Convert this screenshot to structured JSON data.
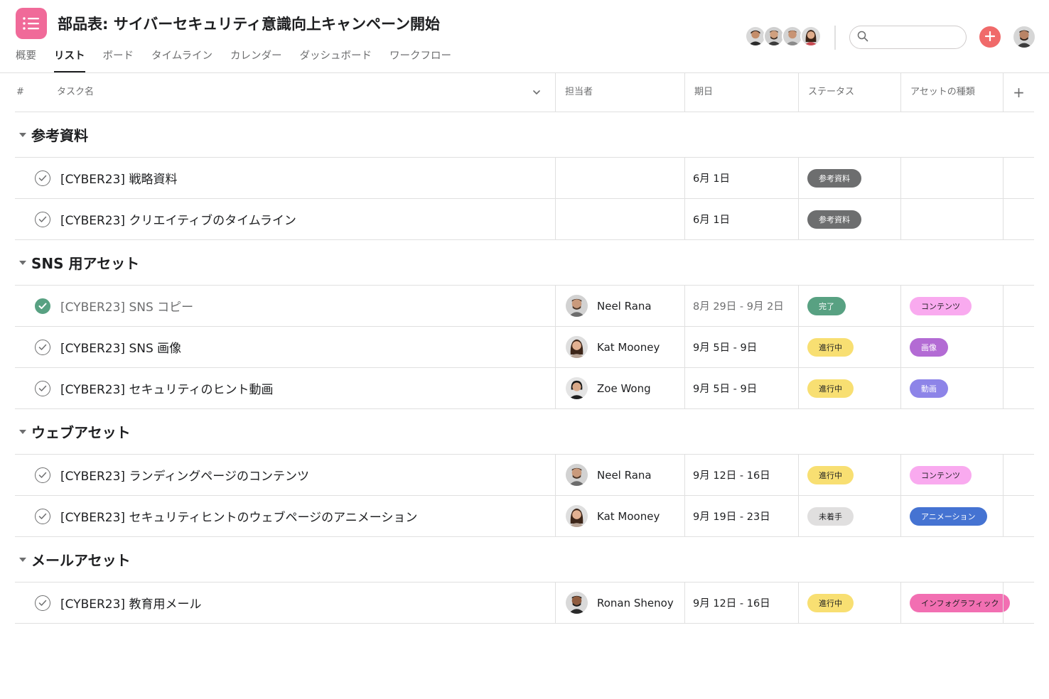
{
  "header": {
    "title": "部品表: サイバーセキュリティ意識向上キャンペーン開始",
    "tabs": [
      "概要",
      "リスト",
      "ボード",
      "タイムライン",
      "カレンダー",
      "ダッシュボード",
      "ワークフロー"
    ],
    "active_tab": "リスト",
    "search_placeholder": "",
    "members": [
      "member-1",
      "member-2",
      "member-3",
      "member-4"
    ]
  },
  "columns": {
    "number": "#",
    "task_name": "タスク名",
    "assignee": "担当者",
    "due_date": "期日",
    "status": "ステータス",
    "asset_type": "アセットの種類",
    "add": "+"
  },
  "sections": [
    {
      "title": "参考資料",
      "tasks": [
        {
          "name": "[CYBER23] 戦略資料",
          "completed": false,
          "assignee": "",
          "avatar": "",
          "due": "6月 1日",
          "status": "参考資料",
          "asset": ""
        },
        {
          "name": "[CYBER23] クリエイティブのタイムライン",
          "completed": false,
          "assignee": "",
          "avatar": "",
          "due": "6月 1日",
          "status": "参考資料",
          "asset": ""
        }
      ]
    },
    {
      "title": "SNS 用アセット",
      "tasks": [
        {
          "name": "[CYBER23] SNS コピー",
          "completed": true,
          "assignee": "Neel Rana",
          "avatar": "male-beard",
          "due": "8月 29日 - 9月 2日",
          "status": "完了",
          "asset": "コンテンツ"
        },
        {
          "name": "[CYBER23] SNS 画像",
          "completed": false,
          "assignee": "Kat Mooney",
          "avatar": "female-long-hair",
          "due": "9月 5日 - 9日",
          "status": "進行中",
          "asset": "画像"
        },
        {
          "name": "[CYBER23] セキュリティのヒント動画",
          "completed": false,
          "assignee": "Zoe Wong",
          "avatar": "female-short-hair",
          "due": "9月 5日 - 9日",
          "status": "進行中",
          "asset": "動画"
        }
      ]
    },
    {
      "title": "ウェブアセット",
      "tasks": [
        {
          "name": "[CYBER23] ランディングページのコンテンツ",
          "completed": false,
          "assignee": "Neel Rana",
          "avatar": "male-beard",
          "due": "9月 12日 - 16日",
          "status": "進行中",
          "asset": "コンテンツ"
        },
        {
          "name": "[CYBER23] セキュリティヒントのウェブページのアニメーション",
          "completed": false,
          "assignee": "Kat Mooney",
          "avatar": "female-long-hair",
          "due": "9月 19日 - 23日",
          "status": "未着手",
          "asset": "アニメーション"
        }
      ]
    },
    {
      "title": "メールアセット",
      "tasks": [
        {
          "name": "[CYBER23] 教育用メール",
          "completed": false,
          "assignee": "Ronan Shenoy",
          "avatar": "male-dark",
          "due": "9月 12日 - 16日",
          "status": "進行中",
          "asset": "インフォグラフィック"
        }
      ]
    }
  ],
  "colors": {
    "app_icon": "#f06a99",
    "add_button": "#f06a6a",
    "status": {
      "参考資料": {
        "bg": "#6d6e6f",
        "fg": "#ffffff"
      },
      "完了": {
        "bg": "#58a182",
        "fg": "#ffffff"
      },
      "進行中": {
        "bg": "#f8df72",
        "fg": "#1e1f21"
      },
      "未着手": {
        "bg": "#e0dfdf",
        "fg": "#1e1f21"
      }
    },
    "asset": {
      "コンテンツ": {
        "bg": "#f9aaef",
        "fg": "#1e1f21"
      },
      "画像": {
        "bg": "#b36bd4",
        "fg": "#ffffff"
      },
      "動画": {
        "bg": "#8d84e8",
        "fg": "#ffffff"
      },
      "アニメーション": {
        "bg": "#4573d2",
        "fg": "#ffffff"
      },
      "インフォグラフィック": {
        "bg": "#f26fb2",
        "fg": "#1e1f21"
      }
    }
  }
}
